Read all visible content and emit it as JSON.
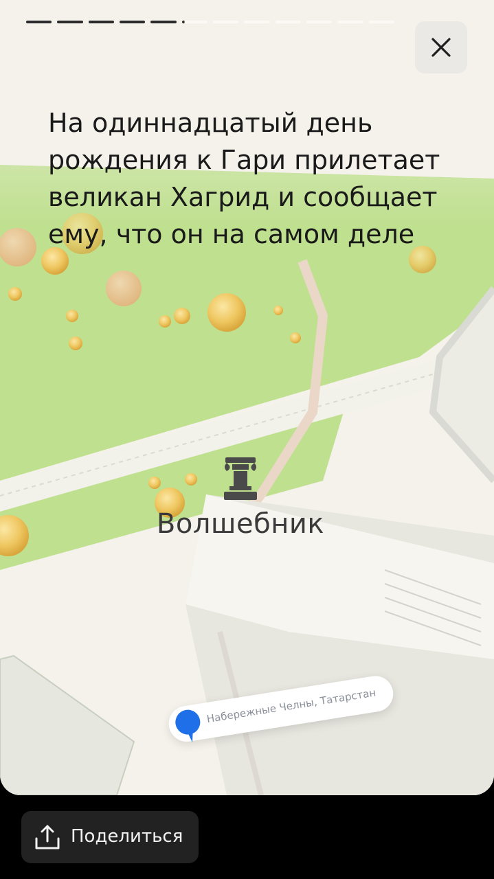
{
  "story": {
    "text": "На одиннадцатый день рождения к Гари прилетает великан Хагрид и сообщает ему, что он на самом деле",
    "progress": {
      "total_segments": 12,
      "completed_segments": 5,
      "current_segment_progress": 0.1
    },
    "close_icon": "close-icon"
  },
  "map": {
    "poi_label": "Волшебник",
    "poi_icon": "monument-icon",
    "location_tag": "Набережные Челны, Татарстан",
    "location_pin_icon": "map-pin-icon"
  },
  "footer": {
    "share_label": "Поделиться",
    "share_icon": "share-icon"
  },
  "colors": {
    "background": "#000000",
    "park_green": "#b9dd8a",
    "map_base": "#f4f2ea",
    "pin_blue": "#1e6fe8",
    "button_dark": "#222222"
  }
}
